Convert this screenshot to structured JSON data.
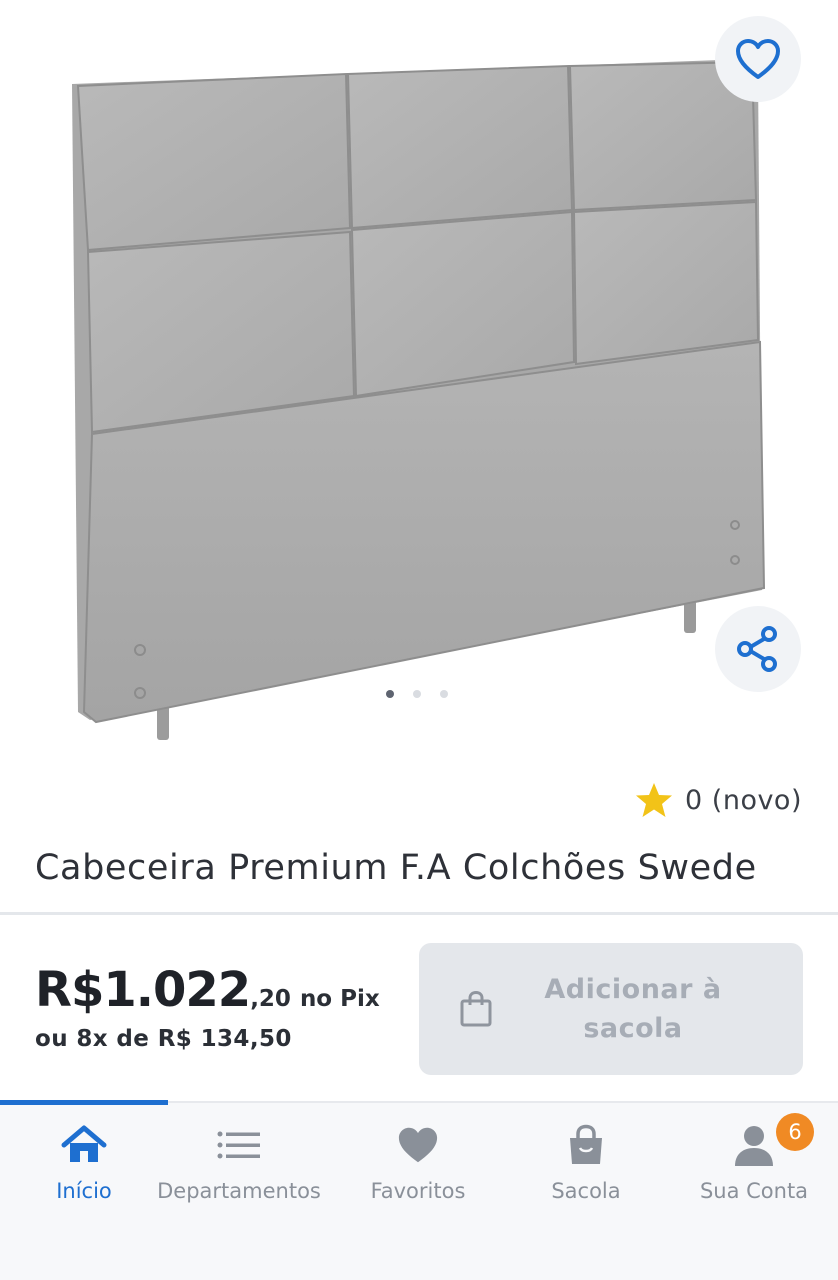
{
  "product": {
    "title": "Cabeceira Premium F.A Colchões Swede",
    "image_icon": "upholstered-headboard-image",
    "carousel": {
      "count": 3,
      "active_index": 0
    },
    "rating": {
      "icon": "star-icon",
      "text": "0 (novo)"
    }
  },
  "actions": {
    "favorite_icon": "heart-outline-icon",
    "share_icon": "share-icon"
  },
  "pricing": {
    "price_int": "R$1.022",
    "price_cents": ",20",
    "pix_suffix": "no Pix",
    "installments": "ou 8x de R$ 134,50"
  },
  "cart_button": {
    "label": "Adicionar à sacola",
    "icon": "shopping-bag-icon"
  },
  "tabbar": {
    "items": [
      {
        "label": "Início",
        "icon": "home-icon",
        "active": true
      },
      {
        "label": "Departamentos",
        "icon": "list-icon",
        "active": false
      },
      {
        "label": "Favoritos",
        "icon": "heart-icon",
        "active": false
      },
      {
        "label": "Sacola",
        "icon": "bag-icon",
        "active": false
      },
      {
        "label": "Sua Conta",
        "icon": "user-icon",
        "active": false,
        "badge": "6"
      }
    ]
  },
  "colors": {
    "accent": "#1e6fd0",
    "badge": "#f08a24",
    "star": "#f2c318",
    "disabled_button": "#e4e7eb",
    "muted_text": "#8a9099"
  }
}
